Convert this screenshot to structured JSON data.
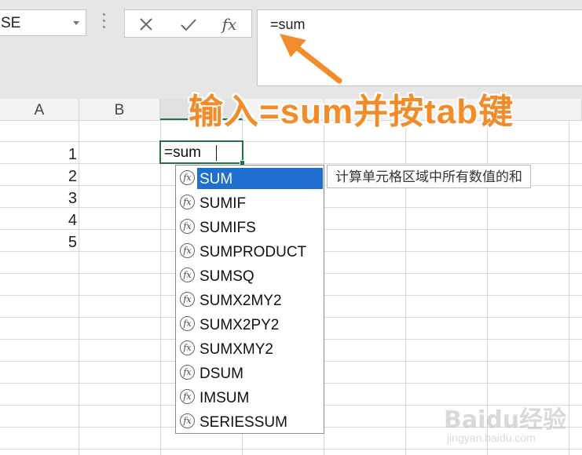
{
  "name_box": {
    "value": "SE"
  },
  "formula_bar": {
    "cancel_icon": "cancel-icon",
    "enter_icon": "enter-check-icon",
    "insert_function_label": "fx",
    "content": "=sum"
  },
  "columns": [
    "A",
    "B",
    "",
    "",
    "",
    "",
    ""
  ],
  "cells": {
    "A": [
      "1",
      "2",
      "3",
      "4",
      "5"
    ],
    "active_cell_text": "=sum"
  },
  "autocomplete": {
    "items": [
      "SUM",
      "SUMIF",
      "SUMIFS",
      "SUMPRODUCT",
      "SUMSQ",
      "SUMX2MY2",
      "SUMX2PY2",
      "SUMXMY2",
      "DSUM",
      "IMSUM",
      "SERIESSUM"
    ],
    "selected": "SUM",
    "tooltip": "计算单元格区域中所有数值的和"
  },
  "annotation": {
    "text": "输入=sum并按tab键",
    "color": "#f28b2a"
  },
  "watermark": {
    "brand": "Baidu经验",
    "url": "jingyan.baidu.com"
  },
  "colors": {
    "accent_green": "#217346",
    "selection_blue": "#1e6fd0"
  }
}
